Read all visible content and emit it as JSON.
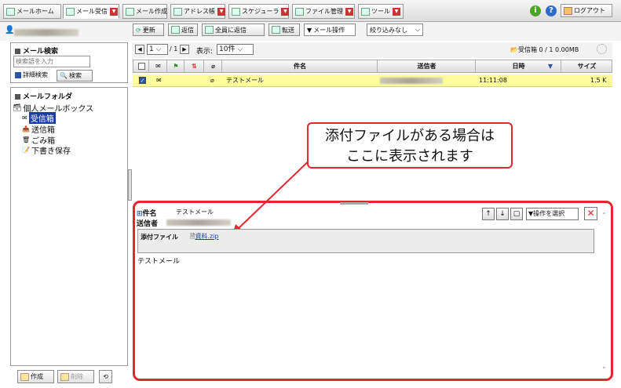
{
  "nav": {
    "tabs": [
      {
        "label": "メールホーム"
      },
      {
        "label": "メール受信"
      },
      {
        "label": "メール作成"
      },
      {
        "label": "アドレス帳"
      },
      {
        "label": "スケジューラ"
      },
      {
        "label": "ファイル管理"
      },
      {
        "label": "ツール"
      }
    ],
    "logout_label": "ログアウト"
  },
  "toolbar": {
    "refresh": "更新",
    "reply": "返信",
    "reply_all": "全員に返信",
    "forward": "転送",
    "mail_ops": "メール操作",
    "filter": "絞り込みなし"
  },
  "search": {
    "title": "メール検索",
    "placeholder": "検索語を入力",
    "detail_label": "詳細検索",
    "search_button": "検索"
  },
  "folders": {
    "title": "メールフォルダ",
    "mailbox": "個人メールボックス",
    "items": [
      "受信箱",
      "送信箱",
      "ごみ箱",
      "下書き保存"
    ]
  },
  "bottom": {
    "create": "作成",
    "delete": "削除"
  },
  "pager": {
    "page": "1",
    "total": "/ 1",
    "display_label": "表示:",
    "per_page": "10件",
    "folder_label": "受信箱",
    "count": "0 / 1",
    "size": "0.00MB"
  },
  "columns": {
    "subject": "件名",
    "sender": "送信者",
    "date": "日時",
    "size": "サイズ"
  },
  "rows": [
    {
      "subject": "テストメール",
      "time": "11:11:08",
      "size": "1.5 K"
    }
  ],
  "callout": {
    "line1": "添付ファイルがある場合は",
    "line2": "ここに表示されます"
  },
  "preview": {
    "subject_label": "件名",
    "subject": "テストメール",
    "sender_label": "送信者",
    "ops_label": "操作を選択",
    "attachment_label": "添付ファイル",
    "attachment_name": "資料.zip",
    "body": "テストメール"
  },
  "colors": {
    "highlight_row": "#fffd9b",
    "callout_red": "#e3262f"
  }
}
